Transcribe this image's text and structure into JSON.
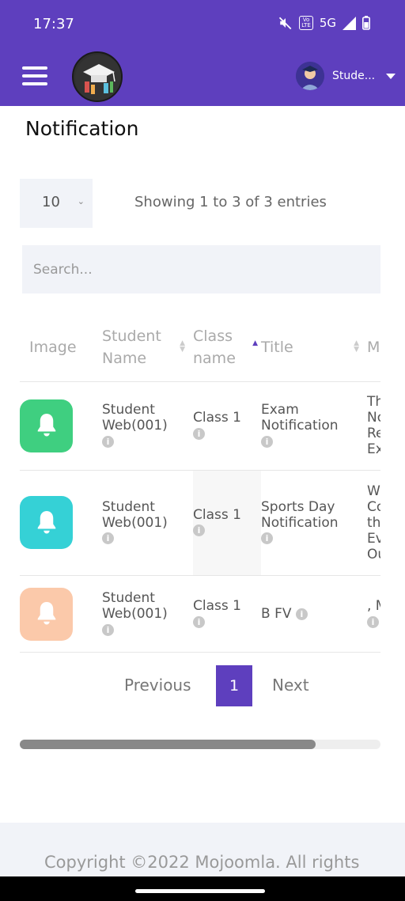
{
  "status_bar": {
    "time": "17:37",
    "volte_top": "Vo",
    "volte_bottom": "LTE",
    "network": "5G"
  },
  "header": {
    "user_name": "Stude..."
  },
  "page": {
    "title": "Notification"
  },
  "table_controls": {
    "page_length": "10",
    "info": "Showing 1 to 3 of 3 entries",
    "search_placeholder": "Search..."
  },
  "table": {
    "columns": [
      {
        "label": "Image"
      },
      {
        "label": "Student Name"
      },
      {
        "label": "Class name"
      },
      {
        "label": "Title"
      },
      {
        "label": "M"
      }
    ],
    "rows": [
      {
        "student": "Student Web(001)",
        "class": "Class 1",
        "title": "Exam Notification",
        "message": "Th No Re Ex",
        "bell_color": "#3fcf80"
      },
      {
        "student": "Student Web(001)",
        "class": "Class 1",
        "title": "Sports Day Notification",
        "message": "W Co th Ev Ou",
        "bell_color": "#35d1d6"
      },
      {
        "student": "Student Web(001)",
        "class": "Class 1",
        "title": "B FV",
        "message": ", M",
        "bell_color": "#fbc9aa"
      }
    ]
  },
  "pagination": {
    "previous": "Previous",
    "current": "1",
    "next": "Next"
  },
  "scrollbar": {
    "position": 0.82
  },
  "footer": {
    "copyright": "Copyright ©2022 Mojoomla. All rights"
  },
  "colors": {
    "brand": "#5e3fbe",
    "surface": "#f1f3f8"
  }
}
